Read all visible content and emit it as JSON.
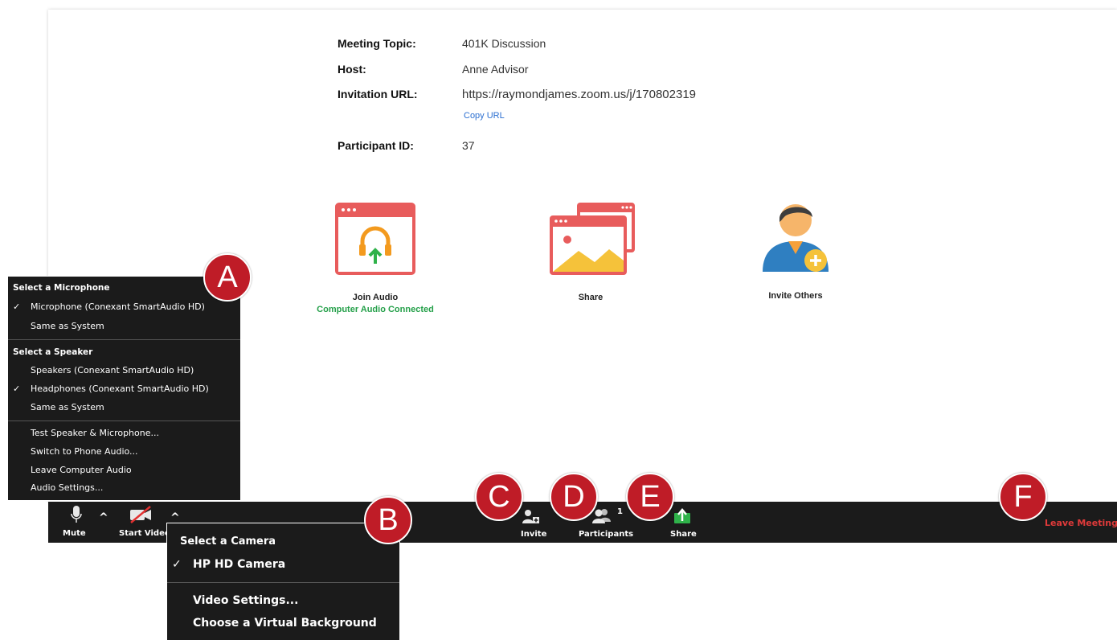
{
  "meeting": {
    "topic_label": "Meeting Topic:",
    "topic_value": "401K Discussion",
    "host_label": "Host:",
    "host_value": "Anne Advisor",
    "url_label": "Invitation URL:",
    "url_value": "https://raymondjames.zoom.us/j/170802319",
    "copy_url": "Copy URL",
    "participant_label": "Participant ID:",
    "participant_value": "37"
  },
  "actions": {
    "join_audio": "Join Audio",
    "join_audio_status": "Computer Audio Connected",
    "share": "Share",
    "invite_others": "Invite Others"
  },
  "audio_menu": {
    "mic_header": "Select a Microphone",
    "mic_items": [
      "Microphone (Conexant SmartAudio HD)",
      "Same as System"
    ],
    "speaker_header": "Select a Speaker",
    "speaker_items": [
      "Speakers (Conexant SmartAudio HD)",
      "Headphones (Conexant SmartAudio HD)",
      "Same as System"
    ],
    "extra_items": [
      "Test Speaker & Microphone...",
      "Switch to Phone Audio...",
      "Leave Computer Audio",
      "Audio Settings..."
    ],
    "check": "✓"
  },
  "camera_menu": {
    "header": "Select a Camera",
    "camera_item": "HP HD Camera",
    "extra_items": [
      "Video Settings...",
      "Choose a Virtual Background"
    ],
    "check": "✓"
  },
  "toolbar": {
    "mute": "Mute",
    "start_video": "Start Video",
    "invite": "Invite",
    "participants": "Participants",
    "participants_count": "1",
    "share": "Share",
    "leave": "Leave Meeting",
    "caret": "^"
  },
  "callouts": [
    "A",
    "B",
    "C",
    "D",
    "E",
    "F"
  ],
  "colors": {
    "callout": "#bf1c27",
    "leave": "#e03a3a",
    "connected": "#25a04a",
    "share_green": "#2fb24a",
    "link": "#2b6fd1"
  }
}
